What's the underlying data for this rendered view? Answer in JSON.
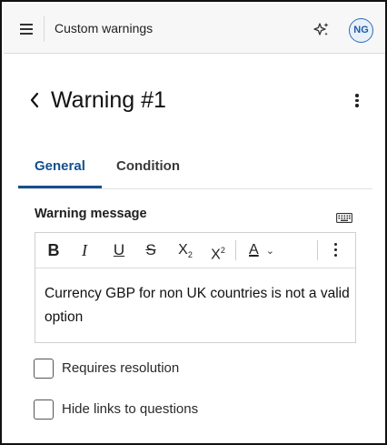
{
  "header": {
    "app_title": "Custom warnings",
    "avatar_initials": "NG",
    "menu_icon": "hamburger-menu-icon",
    "ai_icon": "sparkle-icon"
  },
  "page": {
    "title": "Warning #1",
    "back_icon": "chevron-left-icon",
    "more_icon": "more-vertical-icon"
  },
  "tabs": [
    {
      "label": "General",
      "active": true
    },
    {
      "label": "Condition",
      "active": false
    }
  ],
  "field": {
    "label": "Warning message",
    "keyboard_icon": "keyboard-icon"
  },
  "toolbar": {
    "bold": "B",
    "italic": "I",
    "underline": "U",
    "strikethrough": "S",
    "subscript": "X",
    "subscript_mark": "2",
    "superscript": "X",
    "superscript_mark": "2",
    "font_color": "A"
  },
  "editor": {
    "content": "Currency GBP for non UK countries is not a valid option"
  },
  "options": [
    {
      "label": "Requires resolution",
      "checked": false
    },
    {
      "label": "Hide links to questions",
      "checked": false
    }
  ],
  "colors": {
    "accent": "#15508f",
    "avatar_border": "#2d6dba",
    "topbar_bg": "#f7f7f7"
  }
}
